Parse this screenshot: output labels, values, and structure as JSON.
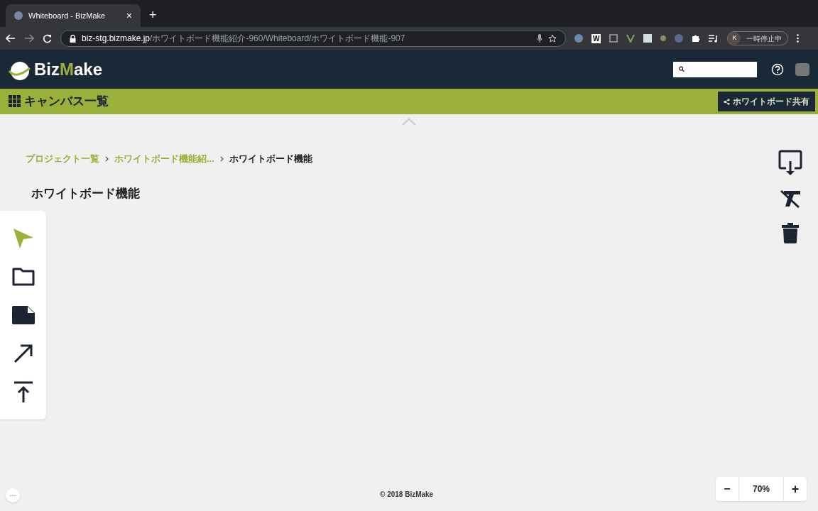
{
  "browser": {
    "tab": {
      "title": "Whiteboard - BizMake",
      "close": "×"
    },
    "new_tab": "+",
    "url": {
      "host": "biz-stg.bizmake.jp",
      "path": "/ホワイトボード機能紹介-960/Whiteboard/ホワイトボード機能-907"
    },
    "extensions": [
      "W"
    ],
    "profile": {
      "initial": "K",
      "status": "一時停止中"
    }
  },
  "header": {
    "logo": [
      {
        "text": "Biz",
        "accent": false
      },
      {
        "text": "M",
        "accent": true
      },
      {
        "text": "ake",
        "accent": false
      }
    ]
  },
  "subbar": {
    "title": "キャンバス一覧",
    "share_button": "ホワイトボード共有"
  },
  "breadcrumb": [
    {
      "label": "プロジェクト一覧",
      "link": true
    },
    {
      "label": "ホワイトボード機能紹...",
      "link": true
    },
    {
      "label": "ホワイトボード機能",
      "link": false
    }
  ],
  "page_title": "ホワイトボード機能",
  "tools": [
    {
      "kind": "pointer",
      "selected": true
    },
    {
      "kind": "folder",
      "selected": false
    },
    {
      "kind": "note",
      "selected": false
    },
    {
      "kind": "arrow",
      "selected": false
    },
    {
      "kind": "upload",
      "selected": false
    }
  ],
  "actions": [
    {
      "kind": "export"
    },
    {
      "kind": "clear-format"
    },
    {
      "kind": "delete"
    }
  ],
  "footer": {
    "more": "···",
    "copyright": "© 2018 BizMake"
  },
  "zoom": {
    "minus": "−",
    "value": "70%",
    "plus": "+"
  }
}
